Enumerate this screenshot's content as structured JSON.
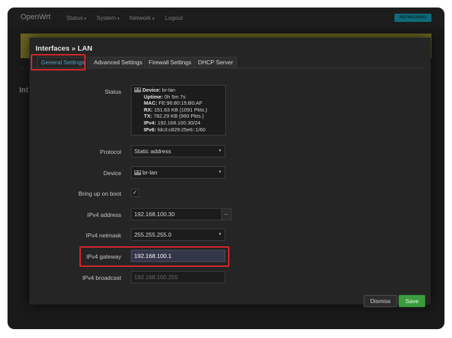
{
  "topbar": {
    "brand": "OpenWrt",
    "nav": [
      "Status",
      "System",
      "Network",
      "Logout"
    ],
    "refresh_label": "REFRESHING"
  },
  "background": {
    "section_heading": "Int"
  },
  "modal": {
    "title": "Interfaces » LAN",
    "tabs": [
      "General Settings",
      "Advanced Settings",
      "Firewall Settings",
      "DHCP Server"
    ],
    "active_tab": "General Settings",
    "status": {
      "label": "Status",
      "device_key": "Device:",
      "device_val": "br-lan",
      "uptime_key": "Uptime:",
      "uptime_val": "0h 5m 7s",
      "mac_key": "MAC:",
      "mac_val": "FE:96:80:15:B0:AF",
      "rx_key": "RX:",
      "rx_val": "151.63 KB (1091 Pkts.)",
      "tx_key": "TX:",
      "tx_val": "782.29 KB (960 Pkts.)",
      "ipv4_key": "IPv4:",
      "ipv4_val": "192.168.100.30/24",
      "ipv6_key": "IPv6:",
      "ipv6_val": "fdc3:c829:25e6::1/60"
    },
    "fields": {
      "protocol": {
        "label": "Protocol",
        "value": "Static address"
      },
      "device": {
        "label": "Device",
        "value": "br-lan"
      },
      "boot": {
        "label": "Bring up on boot",
        "checked": true,
        "mark": "✓"
      },
      "ipv4_address": {
        "label": "IPv4 address",
        "value": "192.168.100.30",
        "more": "..."
      },
      "ipv4_netmask": {
        "label": "IPv4 netmask",
        "value": "255.255.255.0"
      },
      "ipv4_gateway": {
        "label": "IPv4 gateway",
        "value": "192.168.100.1"
      },
      "ipv4_broadcast": {
        "label": "IPv4 broadcast",
        "placeholder": "192.168.100.255"
      }
    },
    "buttons": {
      "dismiss": "Dismiss",
      "save": "Save"
    }
  },
  "colors": {
    "accent_tab": "#4fa3c7",
    "highlight_red": "#e0262a",
    "save_green": "#3a9c3e",
    "alert_yellow": "#6b6423"
  },
  "icons": {
    "network": "network-port-icon",
    "chevron": "chevron-down-icon",
    "check": "checkmark-icon"
  }
}
